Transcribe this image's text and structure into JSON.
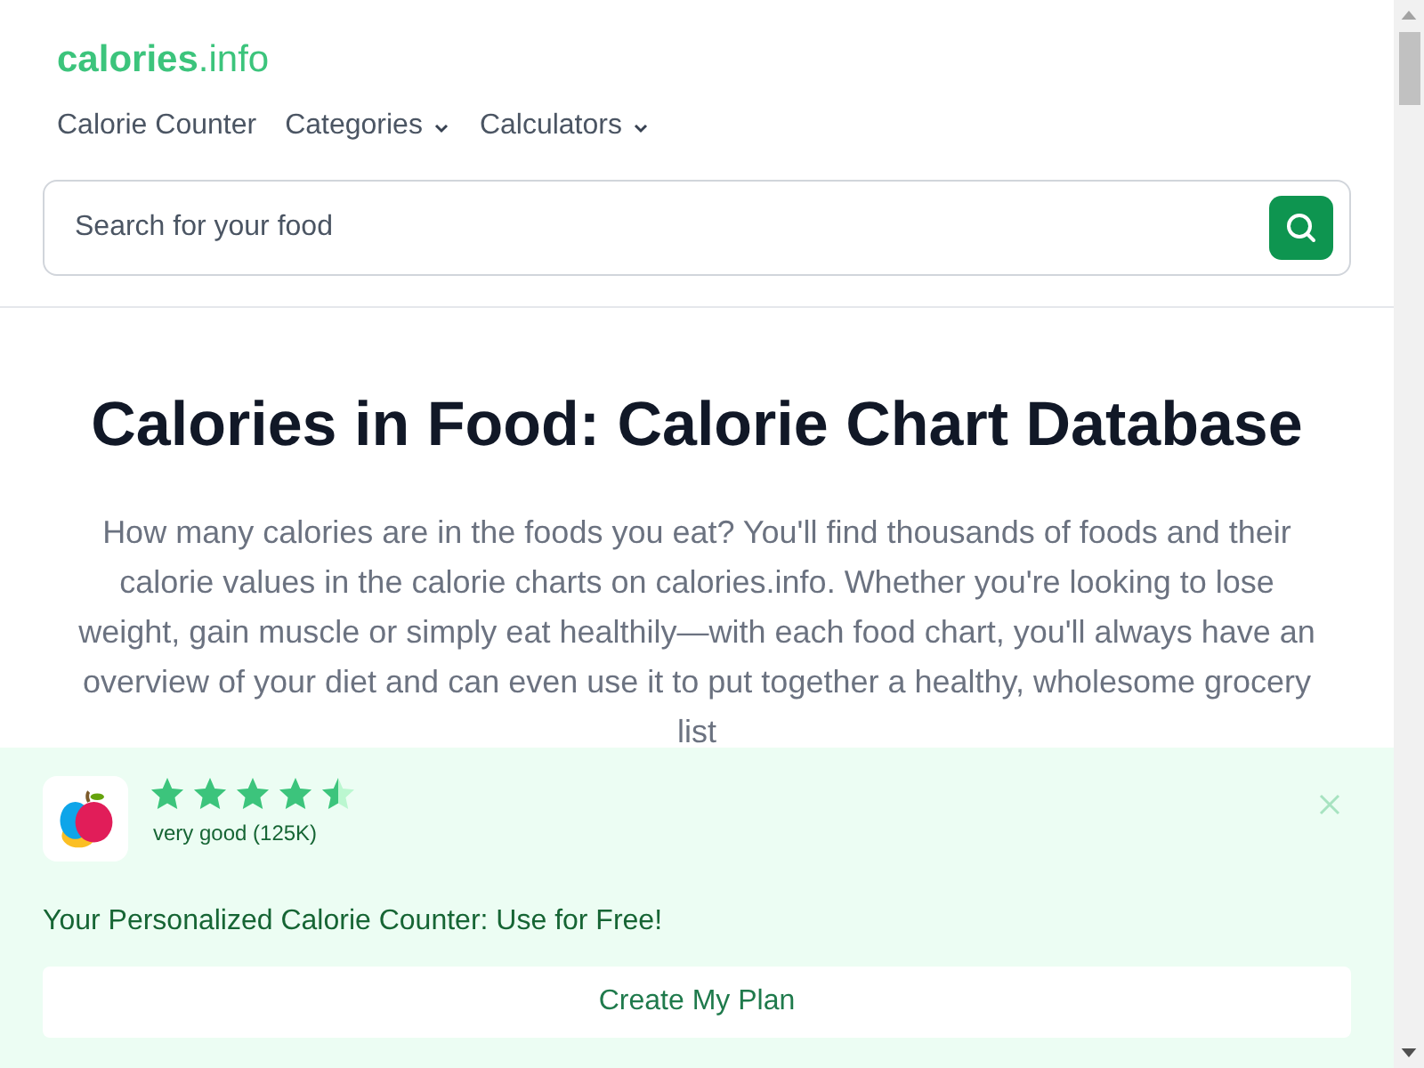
{
  "logo": "**calories**.info",
  "nav": [
    {
      "label": "Calorie Counter",
      "dropdown": false
    },
    {
      "label": "Categories",
      "dropdown": true
    },
    {
      "label": "Calculators",
      "dropdown": true
    }
  ],
  "search": {
    "placeholder": "Search for your food"
  },
  "heading": "Calories in Food: Calorie Chart Database",
  "intro": "How many calories are in the foods you eat? You'll find thousands of foods and their calorie values in the calorie charts on calories.info. Whether you're looking to lose weight, gain muscle or simply eat healthily—with each food chart, you'll always have an overview of your diet and can even use it to put together a healthy, wholesome grocery list",
  "banner": {
    "stars": 4.5,
    "rating": "very good (125K)",
    "tagline": "Your Personalized Calorie Counter: Use for Free!",
    "button": "Create My Plan"
  }
}
